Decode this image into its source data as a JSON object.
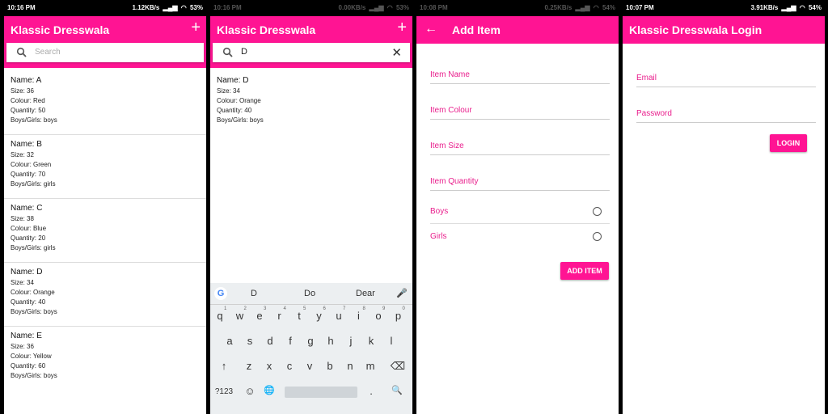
{
  "screen1": {
    "status": {
      "time": "10:16 PM",
      "speed": "1.12KB/s",
      "battery": "53%"
    },
    "app_title": "Klassic Dresswala",
    "add_icon": "+",
    "search_placeholder": "Search",
    "items": [
      {
        "name": "Name: A",
        "size": "Size: 36",
        "colour": "Colour: Red",
        "quantity": "Quantity: 50",
        "gender": "Boys/Girls: boys"
      },
      {
        "name": "Name: B",
        "size": "Size: 32",
        "colour": "Colour: Green",
        "quantity": "Quantity: 70",
        "gender": "Boys/Girls: girls"
      },
      {
        "name": "Name: C",
        "size": "Size: 38",
        "colour": "Colour: Blue",
        "quantity": "Quantity: 20",
        "gender": "Boys/Girls: girls"
      },
      {
        "name": "Name: D",
        "size": "Size: 34",
        "colour": "Colour: Orange",
        "quantity": "Quantity: 40",
        "gender": "Boys/Girls: boys"
      },
      {
        "name": "Name: E",
        "size": "Size: 36",
        "colour": "Colour: Yellow",
        "quantity": "Quantity: 60",
        "gender": "Boys/Girls: boys"
      }
    ]
  },
  "screen2": {
    "status": {
      "time": "10:16 PM",
      "speed": "0.00KB/s",
      "battery": "53%"
    },
    "app_title": "Klassic Dresswala",
    "add_icon": "+",
    "search_value": "D",
    "clear_icon": "✕",
    "items": [
      {
        "name": "Name: D",
        "size": "Size: 34",
        "colour": "Colour: Orange",
        "quantity": "Quantity: 40",
        "gender": "Boys/Girls: boys"
      }
    ],
    "keyboard": {
      "google": "G",
      "suggestions": [
        "D",
        "Do",
        "Dear"
      ],
      "mic": "🎤",
      "row1": [
        "q",
        "w",
        "e",
        "r",
        "t",
        "y",
        "u",
        "i",
        "o",
        "p"
      ],
      "row1_nums": [
        "1",
        "2",
        "3",
        "4",
        "5",
        "6",
        "7",
        "8",
        "9",
        "0"
      ],
      "row2": [
        "a",
        "s",
        "d",
        "f",
        "g",
        "h",
        "j",
        "k",
        "l"
      ],
      "row3": [
        "z",
        "x",
        "c",
        "v",
        "b",
        "n",
        "m"
      ],
      "shift": "↑",
      "backspace": "⌫",
      "symbols": "?123",
      "emoji": "☺",
      "globe": "🌐",
      "period": ".",
      "search": "🔍"
    }
  },
  "screen3": {
    "status": {
      "time": "10:08 PM",
      "speed": "0.25KB/s",
      "battery": "54%"
    },
    "back_icon": "←",
    "app_title": "Add Item",
    "fields": [
      "Item Name",
      "Item Colour",
      "Item Size",
      "Item Quantity"
    ],
    "radios": [
      "Boys",
      "Girls"
    ],
    "button": "ADD ITEM"
  },
  "screen4": {
    "status": {
      "time": "10:07 PM",
      "speed": "3.91KB/s",
      "battery": "54%"
    },
    "app_title": "Klassic Dresswala Login",
    "fields": [
      "Email",
      "Password"
    ],
    "button": "LOGIN"
  }
}
